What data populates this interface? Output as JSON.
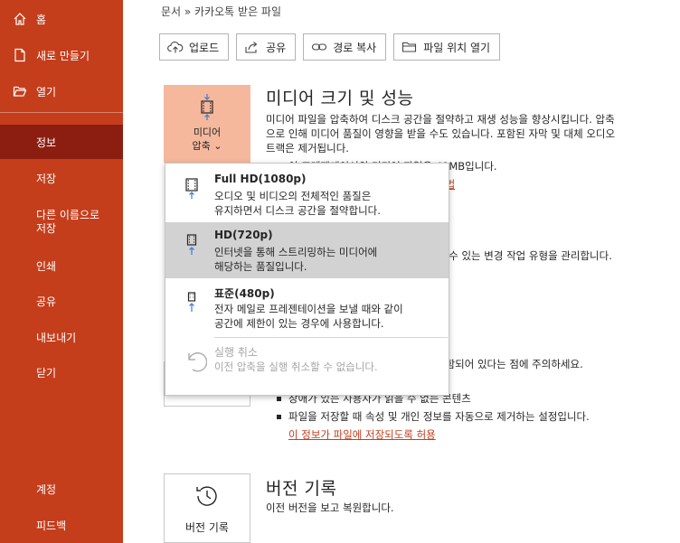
{
  "sidebar": {
    "home": "홈",
    "new": "새로 만들기",
    "open": "열기",
    "info": "정보",
    "save": "저장",
    "save_as_line1": "다른 이름으로",
    "save_as_line2": "저장",
    "print": "인쇄",
    "share": "공유",
    "export": "내보내기",
    "close": "닫기",
    "account": "계정",
    "feedback": "피드백"
  },
  "breadcrumb": "문서 » 카카오톡 받은 파일",
  "actions": {
    "upload": "업로드",
    "share": "공유",
    "copy_path": "경로 복사",
    "open_location": "파일 위치 열기"
  },
  "media": {
    "tile_line1": "미디어",
    "tile_line2": "압축 ⌄",
    "title": "미디어 크기 및 성능",
    "desc_line1": "미디어 파일을 압축하여 디스크 공간을 절약하고 재생 성능을 향상시킵니다. 압축",
    "desc_line2": "으로 인해 미디어 품질이 영향을 받을 수도 있습니다. 포함된 자막 및 대체 오디오",
    "desc_line3": "트랙은 제거됩니다.",
    "size_line": "이 프레젠테이션의 미디어 파일은 48MB입니다.",
    "link": "방법"
  },
  "dropdown": {
    "full_hd_title": "Full HD(1080p)",
    "full_hd_desc1": "오디오 및 비디오의 전체적인 품질은",
    "full_hd_desc2": "유지하면서 디스크 공간을 절약합니다.",
    "hd_title": "HD(720p)",
    "hd_desc1": "인터넷을 통해 스트리밍하는 미디어에",
    "hd_desc2": "해당하는 품질입니다.",
    "std_title": "표준(480p)",
    "std_desc1": "전자 메일로 프레젠테이션을 보낼 때와 같이",
    "std_desc2": "공간에 제한이 있는 경우에 사용합니다.",
    "undo_title": "실행 취소",
    "undo_desc": "이전 압축을 실행 취소할 수 없습니다."
  },
  "protect": {
    "partial": "할 수 있는 변경 작업 유형을 관리합니다."
  },
  "inspect": {
    "partial": "포함되어 있다는 점에 주의하세요.",
    "bullet1": "장애가 있는 사용자가 읽을 수 없는 콘텐츠",
    "bullet2": "파일을 저장할 때 속성 및 개인 정보를 자동으로 제거하는 설정입니다.",
    "link": "이 정보가 파일에 저장되도록 허용"
  },
  "version": {
    "tile_label": "버전 기록",
    "title": "버전 기록",
    "desc": "이전 버전을 보고 복원합니다."
  },
  "colors": {
    "accent": "#c43e1c",
    "active_nav": "#8b1e10",
    "tile": "#f5b89c",
    "highlight": "#d2d2d2",
    "icon_blue": "#3a7bd5"
  }
}
